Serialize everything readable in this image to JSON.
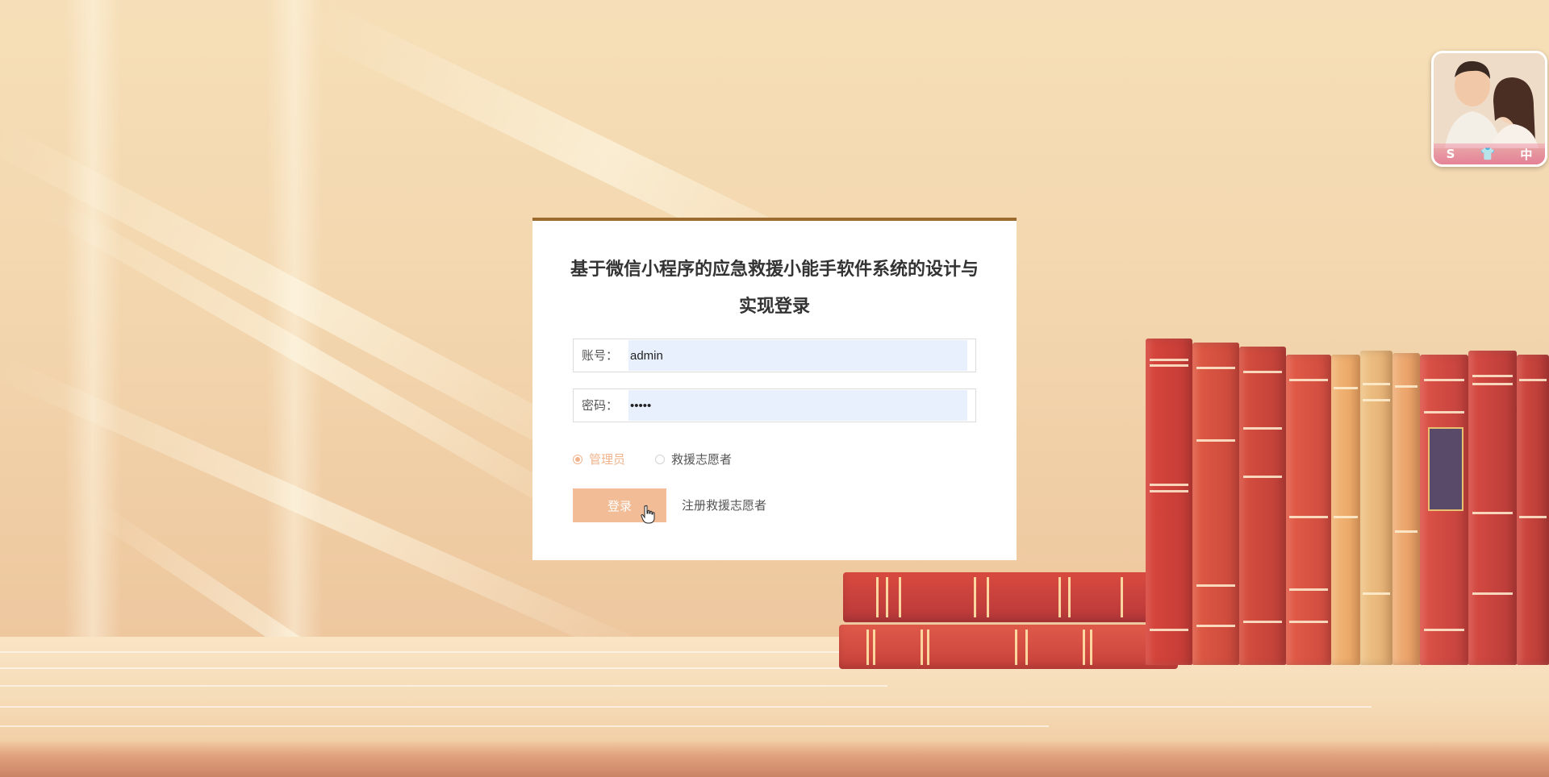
{
  "login": {
    "title": "基于微信小程序的应急救援小能手软件系统的设计与实现登录",
    "account_label": "账号：",
    "account_value": "admin",
    "password_label": "密码：",
    "password_value": "•••••",
    "roles": [
      {
        "label": "管理员",
        "selected": true
      },
      {
        "label": "救援志愿者",
        "selected": false
      }
    ],
    "login_button": "登录",
    "register_link": "注册救援志愿者"
  },
  "widget": {
    "toolbar_glyphs": [
      "S",
      "👕",
      "中"
    ]
  },
  "colors": {
    "accent": "#f2bd96",
    "card_top_border": "#9c6b2f",
    "input_bg": "#e8f0fe",
    "background": "#f3d6ae"
  }
}
